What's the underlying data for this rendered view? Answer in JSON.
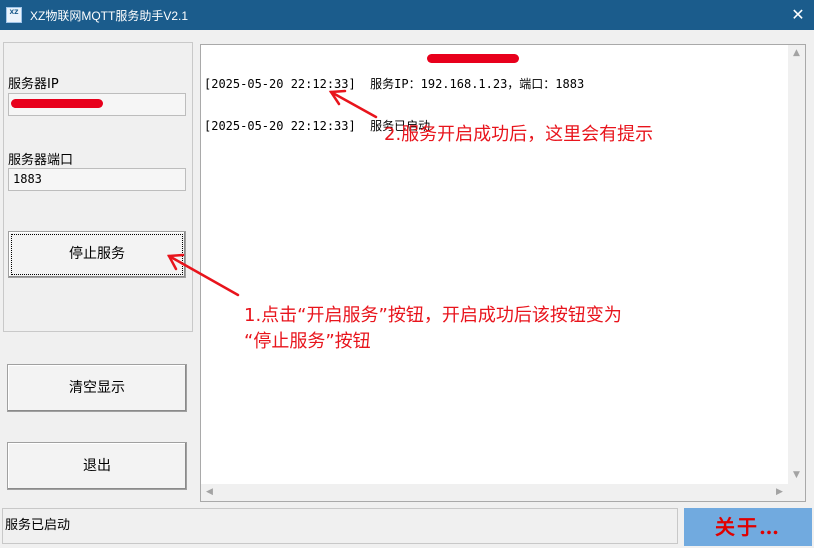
{
  "window": {
    "title": "XZ物联网MQTT服务助手V2.1",
    "icon_text": "XZ",
    "close_glyph": "✕"
  },
  "server": {
    "ip_label": "服务器IP",
    "ip_value": "192.168.1.23",
    "port_label": "服务器端口",
    "port_value": "1883"
  },
  "buttons": {
    "stop_service": "停止服务",
    "clear_display": "清空显示",
    "exit": "退出",
    "about": "关于…"
  },
  "log": {
    "lines": [
      "[2025-05-20 22:12:33]  服务IP：192.168.1.23，端口：1883",
      "[2025-05-20 22:12:33]  服务已启动"
    ]
  },
  "annotations": {
    "note2": "2.服务开启成功后，这里会有提示",
    "note1_line1": "1.点击“开启服务”按钮，开启成功后该按钮变为",
    "note1_line2": "“停止服务”按钮"
  },
  "status": {
    "text": "服务已启动"
  },
  "colors": {
    "titlebar": "#1b5c8c",
    "annotation": "#e8141c",
    "about_bg": "#71aadf",
    "about_text": "#e00000",
    "redaction": "#e8001c"
  },
  "icons": {
    "scroll_up": "▲",
    "scroll_down": "▼",
    "scroll_left": "◀",
    "scroll_right": "▶"
  }
}
